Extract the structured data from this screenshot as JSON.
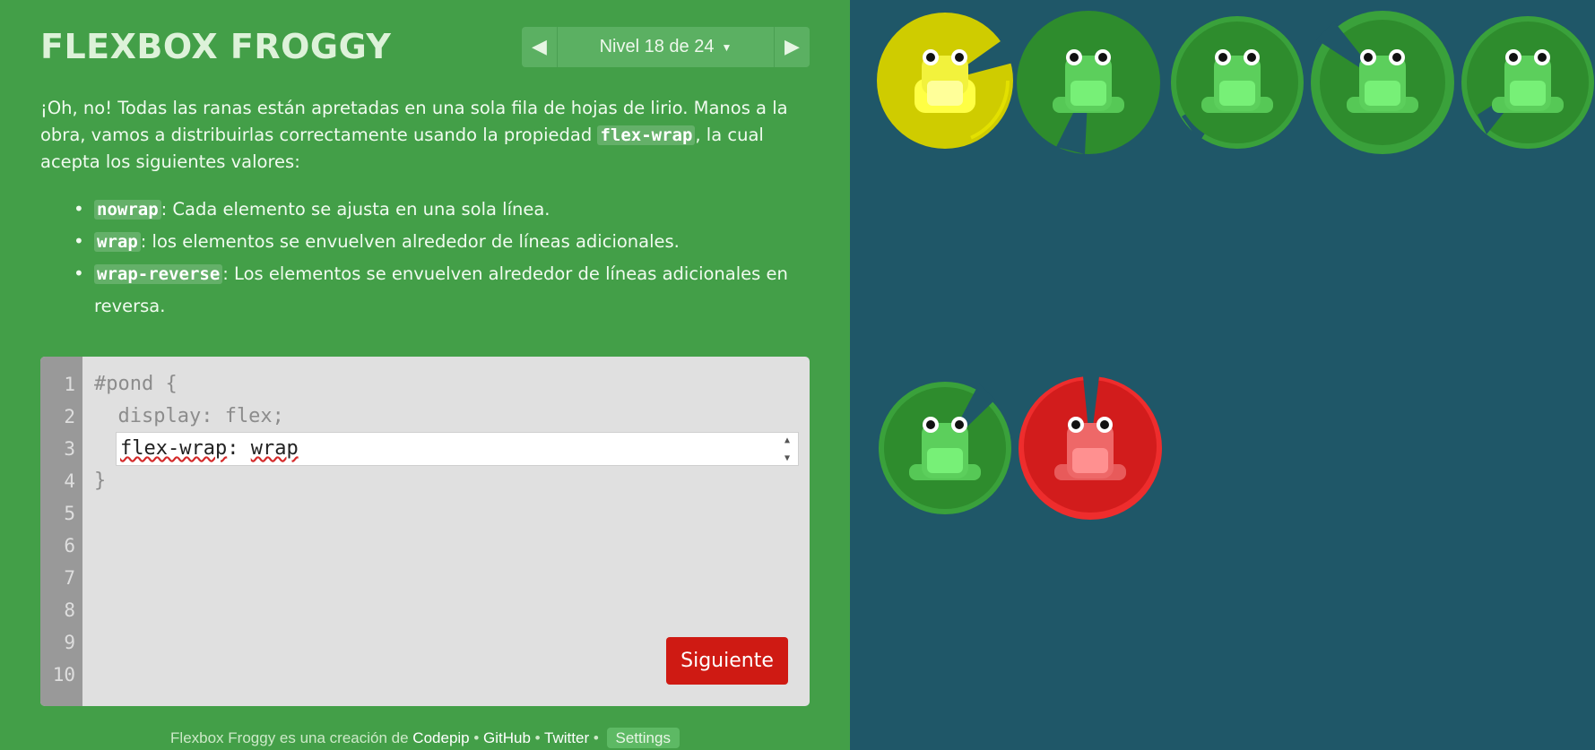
{
  "app": {
    "title": "FLEXBOX FROGGY"
  },
  "level_nav": {
    "prev_icon": "arrow-left-icon",
    "next_icon": "arrow-right-icon",
    "label": "Nivel 18 de 24",
    "caret_icon": "caret-down-icon"
  },
  "instructions": {
    "intro_part1": "¡Oh, no! Todas las ranas están apretadas en una sola fila de hojas de lirio. Manos a la obra, vamos a distribuirlas correctamente usando la propiedad ",
    "intro_code": "flex-wrap",
    "intro_part2": ", la cual acepta los siguientes valores:",
    "options": [
      {
        "code": "nowrap",
        "text": ": Cada elemento se ajusta en una sola línea."
      },
      {
        "code": "wrap",
        "text": ": los elementos se envuelven alrededor de líneas adicionales."
      },
      {
        "code": "wrap-reverse",
        "text": ": Los elementos se envuelven alrededor de líneas adicionales en reversa."
      }
    ]
  },
  "editor": {
    "line_numbers": [
      "1",
      "2",
      "3",
      "4",
      "5",
      "6",
      "7",
      "8",
      "9",
      "10"
    ],
    "code_lines": [
      "#pond {",
      "  display: flex;",
      "",
      "}"
    ],
    "input_value_prop": "flex-wrap",
    "input_value_sep": ": ",
    "input_value_val": "wrap",
    "submit_label": "Siguiente"
  },
  "footer": {
    "text_prefix": "Flexbox Froggy es una creación de ",
    "link_codepip": "Codepip",
    "sep1": " • ",
    "link_github": "GitHub",
    "sep2": " • ",
    "link_twitter": "Twitter",
    "sep3": " • ",
    "settings_label": "Settings"
  },
  "colors": {
    "sidebar_bg": "#439f48",
    "pond_bg": "#1f5768",
    "submit_red": "#cf1a13",
    "pad_yellow": "#cfcc00",
    "pad_green": "#2e8c2d",
    "pad_red": "#d21c1c"
  },
  "pond": {
    "lilypads": [
      "yellow",
      "green",
      "green",
      "green",
      "green",
      "green",
      "red"
    ],
    "frogs": [
      "yellow",
      "green",
      "green",
      "green",
      "green",
      "green",
      "red"
    ]
  }
}
